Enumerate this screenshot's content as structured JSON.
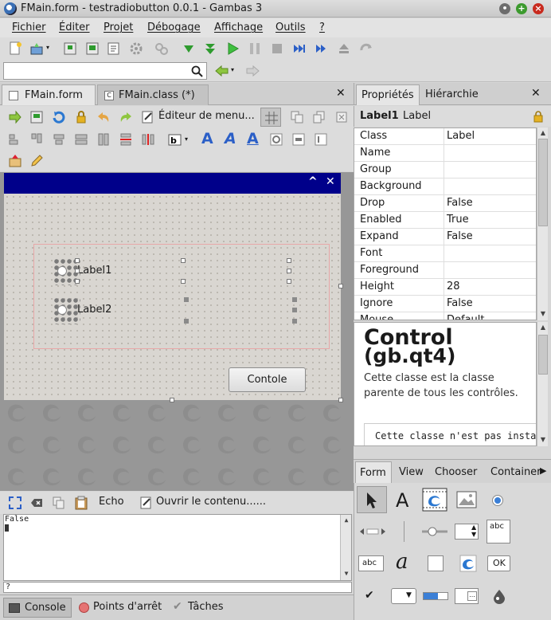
{
  "window": {
    "title": "FMain.form - testradiobutton 0.0.1 - Gambas 3"
  },
  "menu": [
    "Fichier",
    "Éditer",
    "Projet",
    "Débogage",
    "Affichage",
    "Outils",
    "?"
  ],
  "search": {
    "value": "",
    "placeholder": ""
  },
  "editor_tabs": [
    {
      "label": "FMain.form"
    },
    {
      "label": "FMain.class (*)"
    }
  ],
  "form_toolbar": {
    "menu_editor_label": "Éditeur de menu..."
  },
  "form": {
    "labels": [
      "Label1",
      "Label2"
    ],
    "button_label": "Contole"
  },
  "console": {
    "echo_label": "Echo",
    "open_label": "Ouvrir le contenu......",
    "output": "False",
    "prompt": "?"
  },
  "bottom_tabs": [
    "Console",
    "Points d'arrêt",
    "Tâches"
  ],
  "right_tabs": [
    "Propriétés",
    "Hiérarchie"
  ],
  "selection": {
    "name": "Label1",
    "class": "Label"
  },
  "properties": [
    {
      "key": "Class",
      "value": "Label"
    },
    {
      "key": "Name",
      "value": ""
    },
    {
      "key": "Group",
      "value": ""
    },
    {
      "key": "Background",
      "value": ""
    },
    {
      "key": "Drop",
      "value": "False"
    },
    {
      "key": "Enabled",
      "value": "True"
    },
    {
      "key": "Expand",
      "value": "False"
    },
    {
      "key": "Font",
      "value": ""
    },
    {
      "key": "Foreground",
      "value": ""
    },
    {
      "key": "Height",
      "value": "28"
    },
    {
      "key": "Ignore",
      "value": "False"
    },
    {
      "key": "Mouse",
      "value": "Default"
    }
  ],
  "help": {
    "title": "Control",
    "subtitle": "(gb.qt4)",
    "text": "Cette classe est la classe parente de tous les contrôles.",
    "code": "Cette classe n'est pas insta"
  },
  "toolbox_tabs": [
    "Form",
    "View",
    "Chooser",
    "Container"
  ],
  "toolbox_items": {
    "label_glyph": "A",
    "textlabel_glyph": "abc",
    "textbox_glyph": "abc",
    "italic_glyph": "a",
    "ok_glyph": "OK",
    "browse_glyph": "..."
  },
  "colors": {
    "form_title": "#00008a",
    "accent_green": "#2e9b2e",
    "accent_blue": "#2b5fc7"
  }
}
